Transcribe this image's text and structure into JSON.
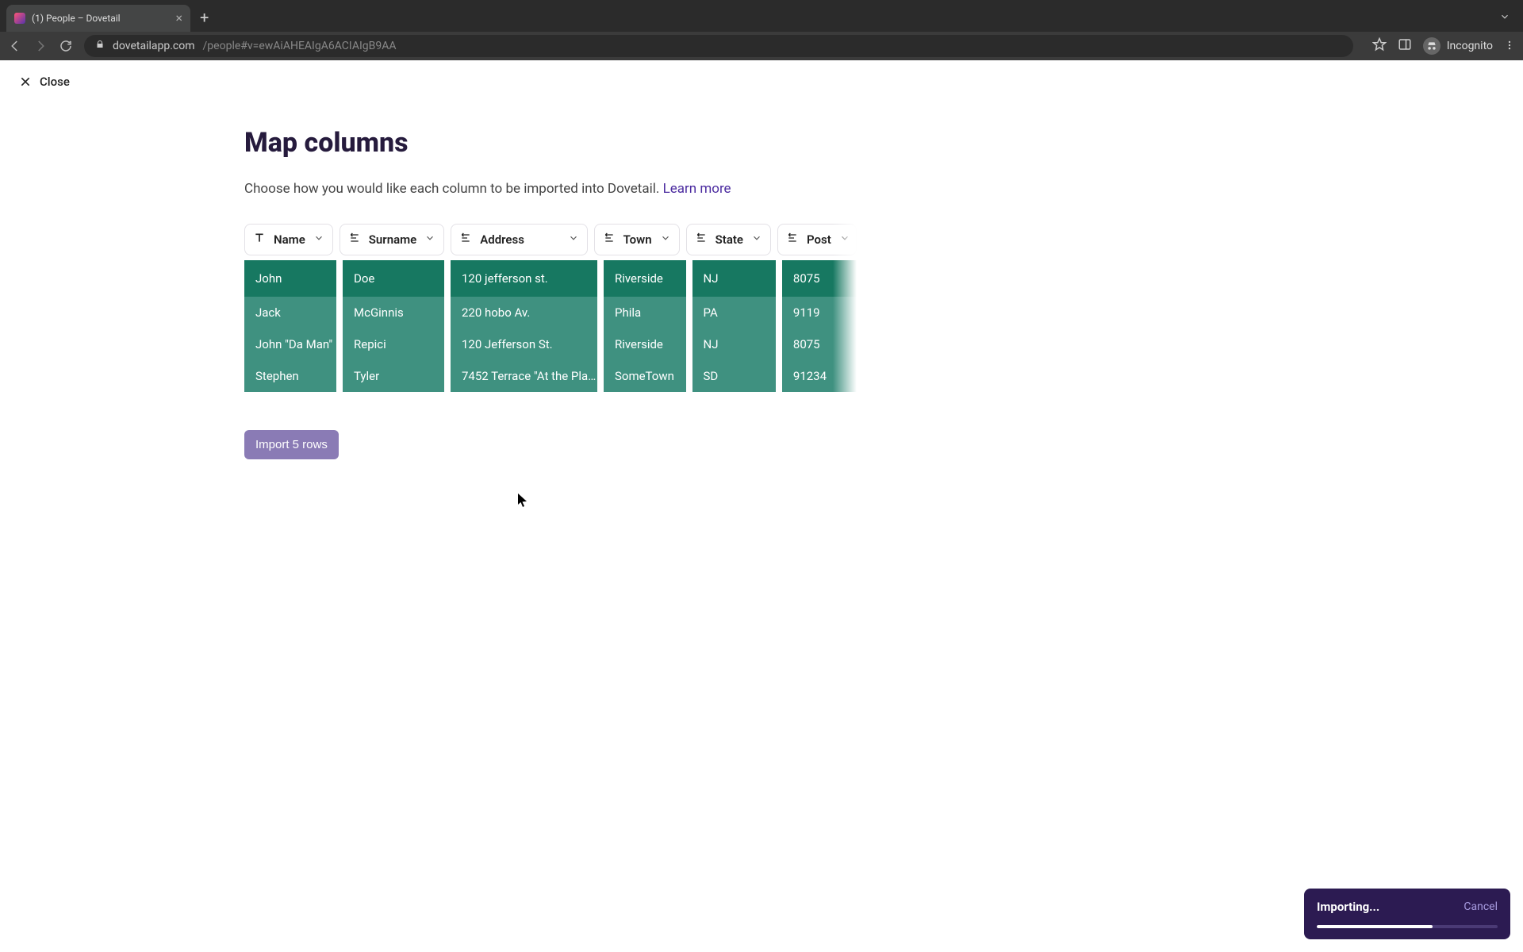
{
  "browser": {
    "tab_title": "(1) People – Dovetail",
    "incognito_label": "Incognito",
    "url_host": "dovetailapp.com",
    "url_path": "/people#v=ewAiAHEAIgA6ACIAIgB9AA"
  },
  "app": {
    "close_label": "Close",
    "title": "Map columns",
    "description_text": "Choose how you would like each column to be imported into Dovetail. ",
    "learn_more": "Learn more",
    "import_button": "Import 5 rows"
  },
  "columns": [
    {
      "key": "name",
      "label": "Name",
      "icon": "text",
      "width": "w-name"
    },
    {
      "key": "surname",
      "label": "Surname",
      "icon": "align",
      "width": "w-surname"
    },
    {
      "key": "address",
      "label": "Address",
      "icon": "align",
      "width": "w-address"
    },
    {
      "key": "town",
      "label": "Town",
      "icon": "align",
      "width": "w-town"
    },
    {
      "key": "state",
      "label": "State",
      "icon": "align",
      "width": "w-state"
    },
    {
      "key": "post",
      "label": "Post",
      "icon": "align",
      "width": "w-post"
    }
  ],
  "rows": [
    {
      "name": "John",
      "surname": "Doe",
      "address": "120 jefferson st.",
      "town": "Riverside",
      "state": "NJ",
      "post": "8075"
    },
    {
      "name": "Jack",
      "surname": "McGinnis",
      "address": "220 hobo Av.",
      "town": "Phila",
      "state": "PA",
      "post": "9119"
    },
    {
      "name": "John \"Da Man\"",
      "surname": "Repici",
      "address": "120 Jefferson St.",
      "town": "Riverside",
      "state": "NJ",
      "post": "8075"
    },
    {
      "name": "Stephen",
      "surname": "Tyler",
      "address": "7452 Terrace \"At the Pla…",
      "town": "SomeTown",
      "state": "SD",
      "post": "91234"
    }
  ],
  "toast": {
    "title": "Importing...",
    "cancel": "Cancel",
    "progress_pct": 64
  }
}
